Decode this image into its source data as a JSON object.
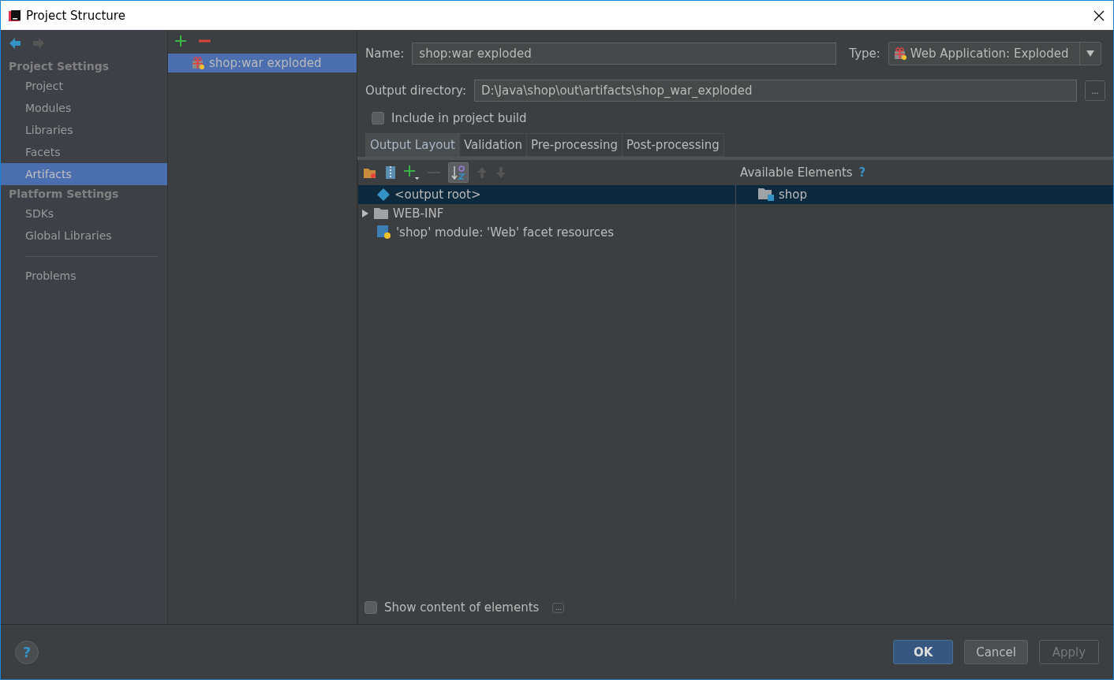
{
  "window": {
    "title": "Project Structure"
  },
  "nav": {
    "sections": [
      {
        "label": "Project Settings",
        "items": [
          {
            "label": "Project",
            "selected": false
          },
          {
            "label": "Modules",
            "selected": false
          },
          {
            "label": "Libraries",
            "selected": false
          },
          {
            "label": "Facets",
            "selected": false
          },
          {
            "label": "Artifacts",
            "selected": true
          }
        ]
      },
      {
        "label": "Platform Settings",
        "items": [
          {
            "label": "SDKs",
            "selected": false
          },
          {
            "label": "Global Libraries",
            "selected": false
          }
        ]
      }
    ],
    "extra": [
      {
        "label": "Problems",
        "selected": false
      }
    ]
  },
  "artifacts": [
    {
      "label": "shop:war exploded",
      "selected": true
    }
  ],
  "form": {
    "name_label": "Name:",
    "name": "shop:war exploded",
    "type_label": "Type:",
    "type": "Web Application: Exploded",
    "output_label": "Output directory:",
    "output": "D:\\Java\\shop\\out\\artifacts\\shop_war_exploded",
    "browse": "...",
    "include": {
      "label": "Include in project build",
      "checked": false
    }
  },
  "tabs": [
    {
      "label": "Output Layout",
      "selected": true
    },
    {
      "label": "Validation",
      "selected": false
    },
    {
      "label": "Pre-processing",
      "selected": false
    },
    {
      "label": "Post-processing",
      "selected": false
    }
  ],
  "layout_tree": [
    {
      "label": "<output root>",
      "kind": "root",
      "selected": true
    },
    {
      "label": "WEB-INF",
      "kind": "folder",
      "selected": false,
      "expanded": false
    },
    {
      "label": "'shop' module: 'Web' facet resources",
      "kind": "module",
      "selected": false
    }
  ],
  "available": {
    "title": "Available Elements",
    "help": "?",
    "items": [
      {
        "label": "shop",
        "selected": true
      }
    ]
  },
  "show_content": {
    "label": "Show content of elements",
    "checked": false,
    "more": "..."
  },
  "help_button": "?",
  "buttons": [
    {
      "label": "OK",
      "kind": "primary",
      "disabled": false
    },
    {
      "label": "Cancel",
      "kind": "normal",
      "disabled": false
    },
    {
      "label": "Apply",
      "kind": "normal",
      "disabled": true
    }
  ]
}
